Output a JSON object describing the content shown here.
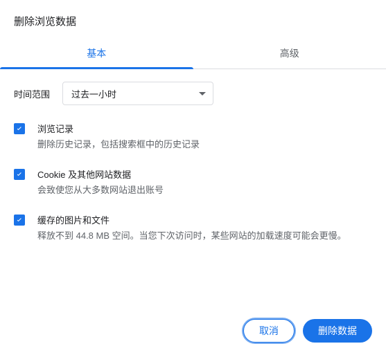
{
  "dialog": {
    "title": "删除浏览数据"
  },
  "tabs": {
    "basic": "基本",
    "advanced": "高级"
  },
  "time": {
    "label": "时间范围",
    "selected": "过去一小时"
  },
  "items": [
    {
      "title": "浏览记录",
      "desc": "删除历史记录，包括搜索框中的历史记录"
    },
    {
      "title": "Cookie 及其他网站数据",
      "desc": "会致使您从大多数网站退出账号"
    },
    {
      "title": "缓存的图片和文件",
      "desc": "释放不到 44.8 MB 空间。当您下次访问时，某些网站的加载速度可能会更慢。"
    }
  ],
  "buttons": {
    "cancel": "取消",
    "confirm": "删除数据"
  },
  "colors": {
    "primary": "#1a73e8",
    "text_secondary": "#5f6368"
  }
}
